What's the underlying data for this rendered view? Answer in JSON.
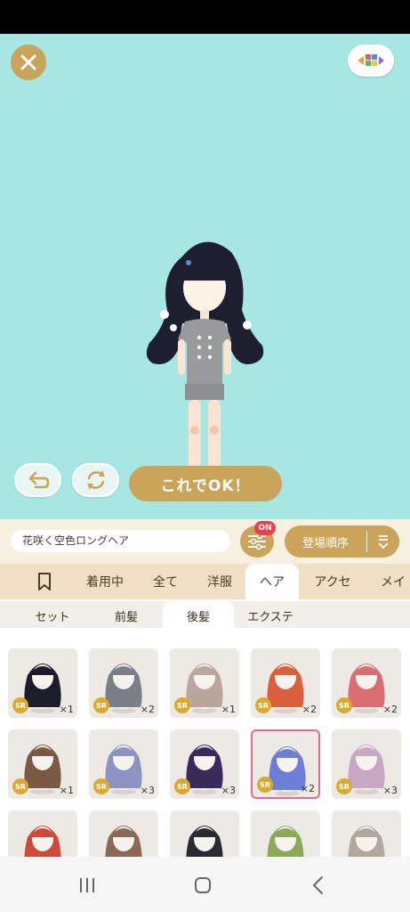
{
  "stage": {
    "ok_label": "これでOK！"
  },
  "toolbar": {
    "item_name": "花咲く空色ロングヘア",
    "filter_badge": "ON",
    "sort_label": "登場順序"
  },
  "tabs": [
    {
      "label": "",
      "icon": "bookmark-icon"
    },
    {
      "label": "着用中"
    },
    {
      "label": "全て"
    },
    {
      "label": "洋服"
    },
    {
      "label": "ヘア",
      "active": true
    },
    {
      "label": "アクセ"
    },
    {
      "label": "メイ"
    }
  ],
  "subtabs": [
    {
      "label": "セット"
    },
    {
      "label": "前髪"
    },
    {
      "label": "後髪",
      "active": true
    },
    {
      "label": "エクステ"
    }
  ],
  "items": [
    {
      "rarity": "SR",
      "qty": "×1",
      "hair_color": "#1c1c2a"
    },
    {
      "rarity": "SR",
      "qty": "×2",
      "hair_color": "#7a7f88"
    },
    {
      "rarity": "SR",
      "qty": "×1",
      "hair_color": "#b8a79a"
    },
    {
      "rarity": "SR",
      "qty": "×2",
      "hair_color": "#d9603a"
    },
    {
      "rarity": "SR",
      "qty": "×2",
      "hair_color": "#d86d72"
    },
    {
      "rarity": "SR",
      "qty": "×1",
      "hair_color": "#7a5a44"
    },
    {
      "rarity": "SR",
      "qty": "×3",
      "hair_color": "#8d94c4"
    },
    {
      "rarity": "SR",
      "qty": "×3",
      "hair_color": "#3a2a5a"
    },
    {
      "rarity": "SR",
      "qty": "×2",
      "hair_color": "#6d7ed8",
      "selected": true
    },
    {
      "rarity": "SR",
      "qty": "×3",
      "hair_color": "#c8a7c2"
    },
    {
      "rarity": "",
      "qty": "",
      "hair_color": "#d04a3a"
    },
    {
      "rarity": "",
      "qty": "",
      "hair_color": "#8a6a55"
    },
    {
      "rarity": "",
      "qty": "",
      "hair_color": "#2a2a32"
    },
    {
      "rarity": "",
      "qty": "",
      "hair_color": "#8aaa5a"
    },
    {
      "rarity": "",
      "qty": "",
      "hair_color": "#b0a89e"
    }
  ],
  "colors": {
    "accent": "#c9a45a",
    "stage_bg": "#a6e6e3",
    "badge_red": "#e8414b",
    "selected_border": "#e46b8b",
    "sr_badge": "#d9aa2e"
  }
}
